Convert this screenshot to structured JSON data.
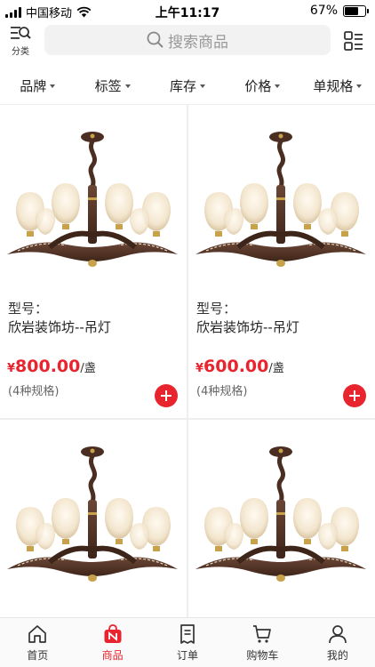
{
  "status_bar": {
    "carrier": "中国移动",
    "time": "上午11:17",
    "battery": "67%",
    "battery_level": 0.67
  },
  "header": {
    "category_label": "分类",
    "search_placeholder": "搜索商品"
  },
  "filters": [
    {
      "label": "品牌"
    },
    {
      "label": "标签"
    },
    {
      "label": "库存"
    },
    {
      "label": "价格"
    },
    {
      "label": "单规格"
    }
  ],
  "products": [
    {
      "model_label": "型号：",
      "name": "欣岩装饰坊--吊灯",
      "currency": "¥",
      "price": "800.00",
      "unit": "/盏",
      "spec": "(4种规格)"
    },
    {
      "model_label": "型号：",
      "name": "欣岩装饰坊--吊灯",
      "currency": "¥",
      "price": "600.00",
      "unit": "/盏",
      "spec": "(4种规格)"
    },
    {
      "model_label": "",
      "name": "",
      "currency": "",
      "price": "",
      "unit": "",
      "spec": ""
    },
    {
      "model_label": "",
      "name": "",
      "currency": "",
      "price": "",
      "unit": "",
      "spec": ""
    }
  ],
  "tabbar": [
    {
      "label": "首页",
      "icon": "home-icon"
    },
    {
      "label": "商品",
      "icon": "goods-bag-icon",
      "active": true
    },
    {
      "label": "订单",
      "icon": "order-icon"
    },
    {
      "label": "购物车",
      "icon": "cart-icon"
    },
    {
      "label": "我的",
      "icon": "user-icon"
    }
  ],
  "colors": {
    "accent": "#e8252f",
    "filter_caret": "#555555",
    "grid_gap": "#eeeeee"
  }
}
